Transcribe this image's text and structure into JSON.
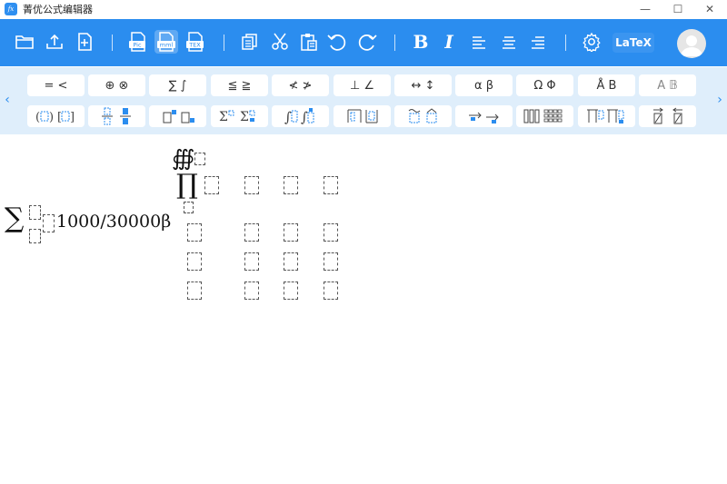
{
  "window": {
    "title": "菁优公式编辑器",
    "icon_label": "fx",
    "minimize": "—",
    "maximize": "☐",
    "close": "✕"
  },
  "toolbar": {
    "bold_label": "B",
    "italic_label": "I",
    "latex_label": "LaTeX",
    "pic_label": "Pic",
    "mml_label": "mml",
    "tex_label": "TEX"
  },
  "palette": {
    "row1": [
      "= <",
      "⊕ ⊗",
      "∑ ∫",
      "≦ ≧",
      "≮ ≯",
      "⊥ ∠",
      "↔ ↕",
      "α β",
      "Ω Φ",
      "Å B",
      "A 𝔹"
    ],
    "left_arrow": "‹",
    "right_arrow": "›"
  },
  "editor": {
    "sum_symbol": "∑",
    "expression": "1000/30000β",
    "contour_symbol": "∰",
    "product_symbol": "∏"
  },
  "colors": {
    "accent": "#2b8def",
    "palette_bg": "#dfeefb"
  }
}
